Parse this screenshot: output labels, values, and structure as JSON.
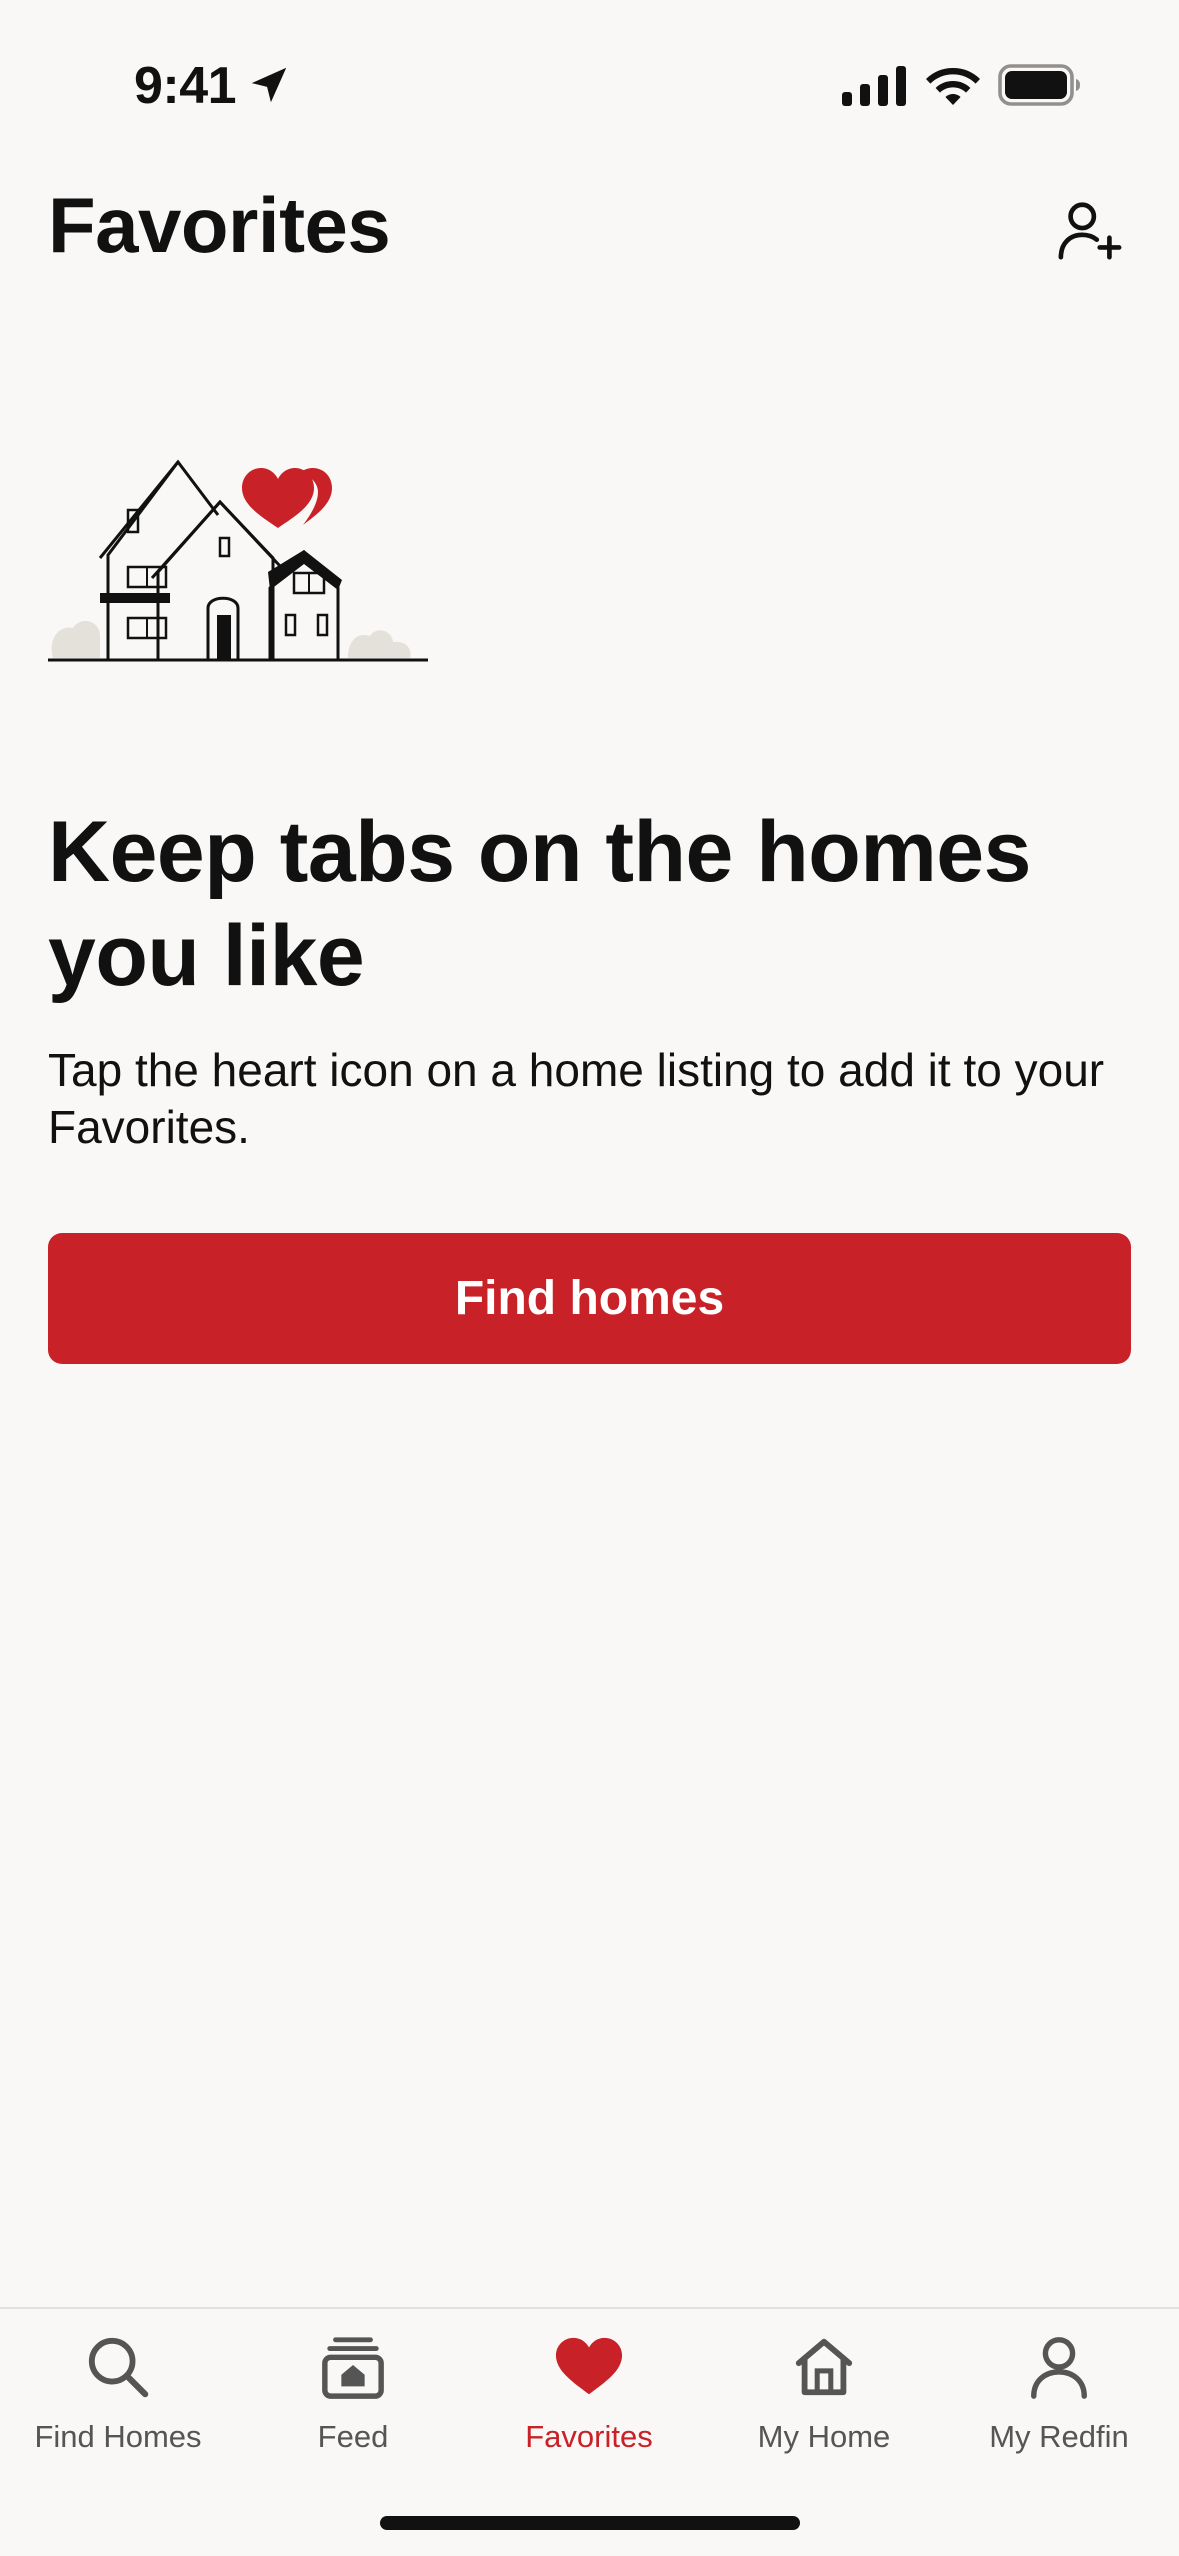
{
  "status_bar": {
    "time": "9:41"
  },
  "header": {
    "title": "Favorites",
    "add_user_icon": "person-plus-icon"
  },
  "illustration": {
    "name": "house-with-hearts-illustration",
    "accent_color": "#c82127"
  },
  "empty_state": {
    "headline": "Keep tabs on the homes you like",
    "body": "Tap the heart icon on a home listing to add it to your Favorites.",
    "button_label": "Find homes"
  },
  "tab_bar": {
    "active_color": "#c82127",
    "inactive_color": "#555555",
    "tabs": [
      {
        "label": "Find Homes",
        "icon": "search-icon",
        "active": false
      },
      {
        "label": "Feed",
        "icon": "feed-icon",
        "active": false
      },
      {
        "label": "Favorites",
        "icon": "heart-icon",
        "active": true
      },
      {
        "label": "My Home",
        "icon": "home-icon",
        "active": false
      },
      {
        "label": "My Redfin",
        "icon": "person-icon",
        "active": false
      }
    ]
  }
}
